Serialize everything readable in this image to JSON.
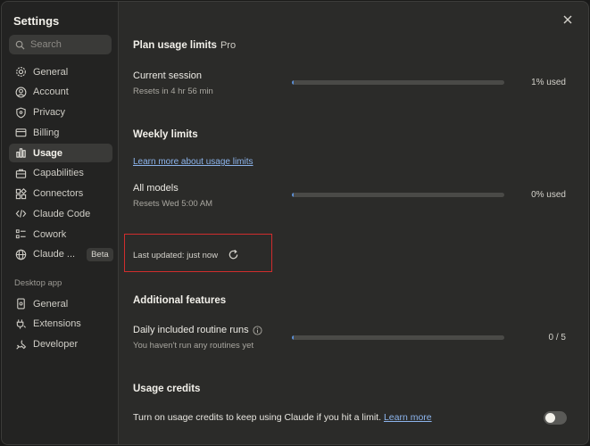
{
  "sidebar": {
    "title": "Settings",
    "search_placeholder": "Search",
    "items": [
      {
        "label": "General",
        "icon": "gear-icon"
      },
      {
        "label": "Account",
        "icon": "user-circle-icon"
      },
      {
        "label": "Privacy",
        "icon": "shield-icon"
      },
      {
        "label": "Billing",
        "icon": "credit-card-icon"
      },
      {
        "label": "Usage",
        "icon": "bar-chart-icon",
        "active": true
      },
      {
        "label": "Capabilities",
        "icon": "briefcase-icon"
      },
      {
        "label": "Connectors",
        "icon": "puzzle-icon"
      },
      {
        "label": "Claude Code",
        "icon": "code-icon"
      },
      {
        "label": "Cowork",
        "icon": "checklist-icon"
      },
      {
        "label": "Claude ...",
        "icon": "globe-icon",
        "badge": "Beta"
      }
    ],
    "desktop_section": "Desktop app",
    "desktop_items": [
      {
        "label": "General",
        "icon": "phone-gear-icon"
      },
      {
        "label": "Extensions",
        "icon": "plug-icon"
      },
      {
        "label": "Developer",
        "icon": "wrench-icon"
      }
    ]
  },
  "plan": {
    "heading": "Plan usage limits",
    "plan_name": "Pro",
    "current_session": {
      "label": "Current session",
      "sub": "Resets in 4 hr 56 min",
      "used_label": "1% used",
      "used_fraction": 0.01
    }
  },
  "weekly": {
    "heading": "Weekly limits",
    "learn_more": "Learn more about usage limits",
    "all_models": {
      "label": "All models",
      "sub": "Resets Wed 5:00 AM",
      "used_label": "0% used",
      "used_fraction": 0.0
    }
  },
  "last_updated": "Last updated: just now",
  "additional": {
    "heading": "Additional features",
    "routine": {
      "label": "Daily included routine runs",
      "sub": "You haven't run any routines yet",
      "count_label": "0 / 5",
      "used_fraction": 0.0
    }
  },
  "credits": {
    "heading": "Usage credits",
    "text": "Turn on usage credits to keep using Claude if you hit a limit.",
    "link": "Learn more",
    "enabled": false
  },
  "colors": {
    "accent": "#5b8fd6",
    "link": "#8cb4ec",
    "highlight": "#d02d2d"
  }
}
